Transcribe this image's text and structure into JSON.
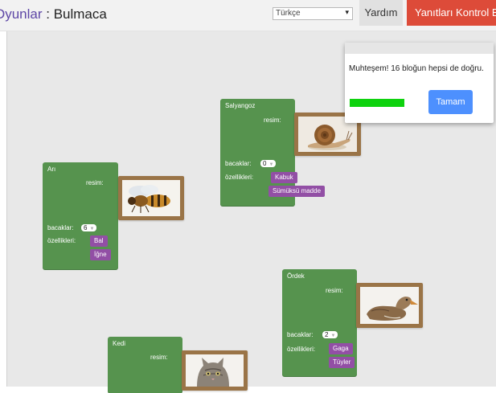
{
  "header": {
    "breadcrumb_link": "Oyunlar",
    "breadcrumb_sep": " : ",
    "page_title": "Bulmaca",
    "language_value": "Türkçe",
    "help_label": "Yardım",
    "check_label": "Yanıtları Kontrol Et"
  },
  "labels": {
    "image": "resim:",
    "legs": "bacaklar:",
    "traits": "özellikleri:"
  },
  "blocks": {
    "snail": {
      "name": "Salyangoz",
      "legs": "0",
      "traits": [
        "Kabuk",
        "Sümüksü madde"
      ],
      "image_icon": "snail-image"
    },
    "bee": {
      "name": "Arı",
      "legs": "6",
      "traits": [
        "Bal",
        "İğne"
      ],
      "image_icon": "bee-image"
    },
    "duck": {
      "name": "Ördek",
      "legs": "2",
      "traits": [
        "Gaga",
        "Tüyler"
      ],
      "image_icon": "duck-image"
    },
    "cat": {
      "name": "Kedi",
      "image_icon": "cat-image"
    }
  },
  "dialog": {
    "message": "Muhteşem! 16 bloğun hepsi de doğru.",
    "progress": 1.0,
    "progress_color": "#0ed20e",
    "ok_label": "Tamam"
  },
  "colors": {
    "block_green": "#56934e",
    "trait_purple": "#924fa5",
    "frame_brown": "#9a7447",
    "check_button_red": "#dd4b39",
    "ok_button_blue": "#4d90fe"
  }
}
